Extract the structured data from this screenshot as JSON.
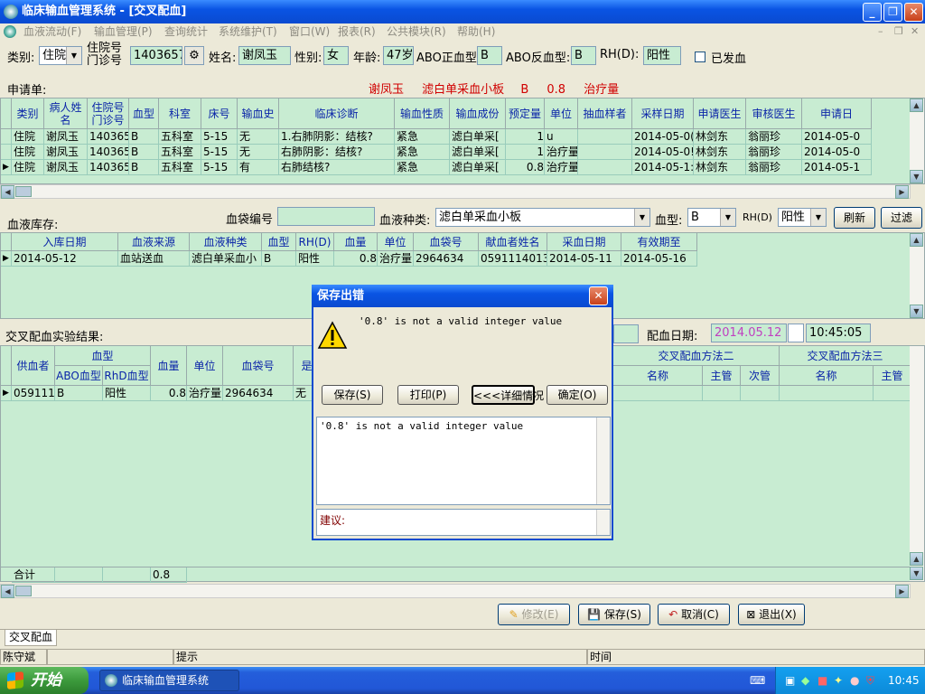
{
  "window": {
    "title": "临床输血管理系统 - [交叉配血]"
  },
  "menu": [
    "血液流动(F)",
    "输血管理(P)",
    "查询统计",
    "系统维护(T)",
    "窗口(W)",
    "报表(R)",
    "公共模块(R)",
    "帮助(H)"
  ],
  "patient": {
    "category_label": "类别:",
    "category_value": "住院",
    "id_label_top": "住院号",
    "id_label_bottom": "门诊号",
    "id_value": "1403657",
    "name_label": "姓名:",
    "name_value": "谢凤玉",
    "sex_label": "性别:",
    "sex_value": "女",
    "age_label": "年龄:",
    "age_value": "47岁",
    "abo_fwd_label": "ABO正血型:",
    "abo_fwd_value": "B",
    "abo_rev_label": "ABO反血型:",
    "abo_rev_value": "B",
    "rh_label": "RH(D):",
    "rh_value": "阳性",
    "issued_label": "已发血"
  },
  "request": {
    "label": "申请单:",
    "summary": {
      "name": "谢凤玉",
      "product": "滤白单采血小板",
      "blood_type": "B",
      "qty": "0.8",
      "unit": "治疗量"
    },
    "columns": [
      "类别",
      "病人姓名",
      "住院号\n门诊号",
      "血型",
      "科室",
      "床号",
      "输血史",
      "临床诊断",
      "输血性质",
      "输血成份",
      "预定量",
      "单位",
      "抽血样者",
      "采样日期",
      "申请医生",
      "审核医生",
      "申请日"
    ],
    "rows": [
      [
        "住院",
        "谢凤玉",
        "140365",
        "B",
        "五科室",
        "5-15",
        "无",
        "1.右肺阴影：结核?",
        "紧急",
        "滤白单采[",
        "1",
        "u",
        "",
        "2014-05-0(",
        "林剑东",
        "翁丽珍",
        "2014-05-0"
      ],
      [
        "住院",
        "谢凤玉",
        "140365",
        "B",
        "五科室",
        "5-15",
        "无",
        "右肺阴影：结核?",
        "紧急",
        "滤白单采[",
        "1",
        "治疗量",
        "",
        "2014-05-0!",
        "林剑东",
        "翁丽珍",
        "2014-05-0"
      ],
      [
        "住院",
        "谢凤玉",
        "140365",
        "B",
        "五科室",
        "5-15",
        "有",
        "右肺结核?",
        "紧急",
        "滤白单采[",
        "0.8",
        "治疗量",
        "",
        "2014-05-1:",
        "林剑东",
        "翁丽珍",
        "2014-05-1"
      ]
    ]
  },
  "inventory": {
    "label": "血液库存:",
    "bag_no_label": "血袋编号",
    "type_label": "血液种类:",
    "type_value": "滤白单采血小板",
    "abo_label": "血型:",
    "abo_value": "B",
    "rh_label": "RH(D)",
    "rh_value": "阳性",
    "refresh_btn": "刷新",
    "filter_btn": "过滤",
    "columns": [
      "入库日期",
      "血液来源",
      "血液种类",
      "血型",
      "RH(D)",
      "血量",
      "单位",
      "血袋号",
      "献血者姓名",
      "采血日期",
      "有效期至"
    ],
    "rows": [
      [
        "2014-05-12",
        "血站送血",
        "滤白单采血小",
        "B",
        "阳性",
        "0.8",
        "治疗量",
        "2964634",
        "0591114013",
        "2014-05-11",
        "2014-05-16"
      ]
    ]
  },
  "crossmatch": {
    "label": "交叉配血实验结果:",
    "date_label": "配血日期:",
    "date_value": "2014.05.12",
    "time_value": "10:45:05",
    "col_donor": "供血者",
    "col_bloodtype": "血型",
    "col_abo": "ABO血型",
    "col_rhd": "RhD血型",
    "col_qty": "血量",
    "col_unit": "单位",
    "col_bag": "血袋号",
    "col_is": "是",
    "method2": "交叉配血方法二",
    "method3": "交叉配血方法三",
    "sub_name": "名称",
    "sub_main": "主管",
    "sub_minor": "次管",
    "row": [
      "059111<",
      "B",
      "阳性",
      "0.8",
      "治疗量",
      "2964634",
      "无",
      ""
    ],
    "total_label": "合计",
    "total_value": "0.8"
  },
  "actions": {
    "modify": "修改(E)",
    "save": "保存(S)",
    "cancel": "取消(C)",
    "exit": "退出(X)"
  },
  "tab": "交叉配血",
  "statusbar": {
    "user": "陈守斌",
    "hint_label": "提示",
    "time_label": "时间"
  },
  "dialog": {
    "title": "保存出错",
    "message": "'0.8' is not a valid integer value",
    "btn_save": "保存(S)",
    "btn_print": "打印(P)",
    "btn_detail": "<<<详细情况",
    "btn_ok": "确定(O)",
    "detail": "'0.8' is not a valid integer value",
    "suggest_label": "建议:"
  },
  "taskbar": {
    "start": "开始",
    "task": "临床输血管理系统",
    "clock": "10:45"
  }
}
